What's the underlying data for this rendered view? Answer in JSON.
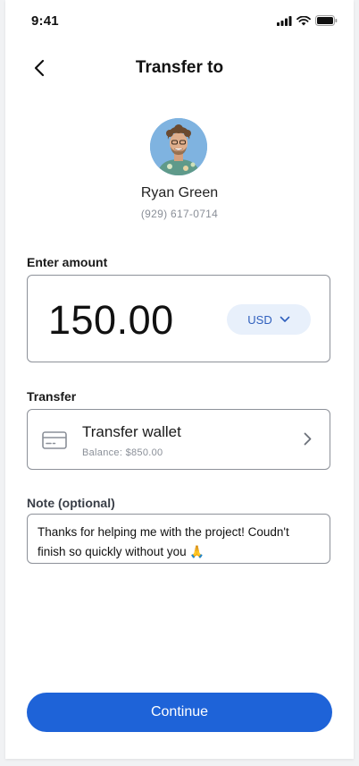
{
  "status_bar": {
    "time": "9:41"
  },
  "header": {
    "title": "Transfer to"
  },
  "recipient": {
    "name": "Ryan Green",
    "phone": "(929) 617-0714"
  },
  "amount": {
    "label": "Enter amount",
    "value": "150.00",
    "currency": "USD"
  },
  "transfer": {
    "label": "Transfer",
    "wallet_name": "Transfer wallet",
    "balance": "Balance:  $850.00"
  },
  "note": {
    "label": "Note (optional)",
    "value": "Thanks for helping me with the project! Coudn't finish so quickly without you 🙏"
  },
  "actions": {
    "continue_label": "Continue"
  },
  "colors": {
    "primary": "#1e63d8",
    "currency_bg": "#e8f0fb",
    "currency_text": "#2f5fbd",
    "muted_text": "#8a8f98"
  }
}
